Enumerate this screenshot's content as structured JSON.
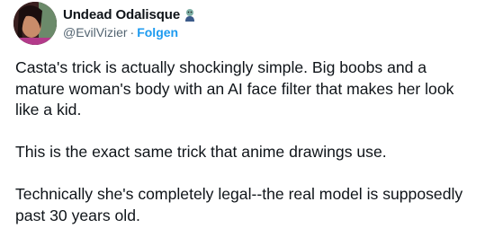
{
  "author": {
    "display_name": "Undead Odalisque",
    "badge_icon": "zombie-emoji-icon",
    "handle": "@EvilVizier",
    "separator": "·",
    "follow_label": "Folgen"
  },
  "tweet": {
    "paragraphs": [
      "Casta's trick is actually shockingly simple. Big boobs and a mature woman's body with an AI face filter that makes her look like a kid.",
      "This is the exact same trick that anime drawings use.",
      "Technically she's completely legal--the real model is supposedly past 30 years old."
    ]
  },
  "colors": {
    "text": "#0f1419",
    "secondary": "#536471",
    "accent": "#1d9bf0"
  }
}
